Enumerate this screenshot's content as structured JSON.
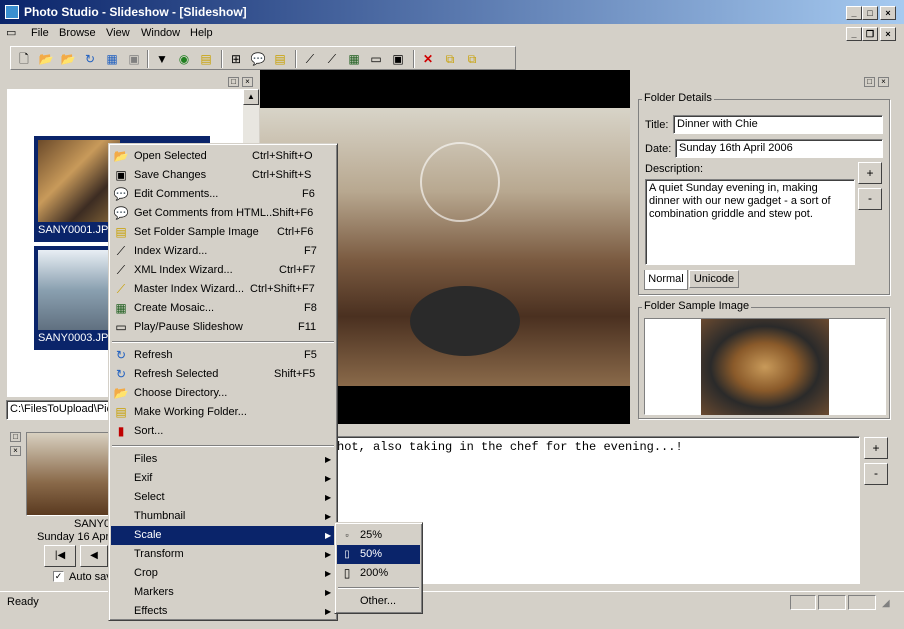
{
  "window": {
    "title": "Photo Studio - Slideshow - [Slideshow]"
  },
  "menubar": [
    "File",
    "Browse",
    "View",
    "Window",
    "Help"
  ],
  "toolbar_icons": [
    "new-icon",
    "open-icon",
    "open-web-icon",
    "refresh-icon",
    "index-icon",
    "save-icon",
    "comments-icon",
    "globe-icon",
    "folder-refresh-icon",
    "mosaic-icon",
    "speech-icon",
    "folder-comments-icon",
    "wand-icon",
    "xml-wand-icon",
    "grid-icon",
    "slideshow-icon",
    "presentation-icon",
    "delete-icon",
    "copy-icon",
    "paste-icon"
  ],
  "thumbnails": [
    {
      "caption": "SANY0001.JPG"
    },
    {
      "caption": "SANY0003.JPG"
    }
  ],
  "path_field": "C:\\FilesToUpload\\Pictures",
  "context_menu": {
    "items": [
      {
        "label": "Open Selected",
        "shortcut": "Ctrl+Shift+O",
        "icon": "open-icon"
      },
      {
        "label": "Save Changes",
        "shortcut": "Ctrl+Shift+S",
        "icon": "save-icon"
      },
      {
        "label": "Edit Comments...",
        "shortcut": "F6",
        "icon": "comment-icon"
      },
      {
        "label": "Get Comments from HTML...",
        "shortcut": "Shift+F6",
        "icon": "html-comment-icon"
      },
      {
        "label": "Set Folder Sample Image",
        "shortcut": "Ctrl+F6",
        "icon": "folder-image-icon"
      },
      {
        "label": "Index Wizard...",
        "shortcut": "F7",
        "icon": "wand-icon"
      },
      {
        "label": "XML Index Wizard...",
        "shortcut": "Ctrl+F7",
        "icon": "xml-wand-icon"
      },
      {
        "label": "Master Index Wizard...",
        "shortcut": "Ctrl+Shift+F7",
        "icon": "master-wand-icon"
      },
      {
        "label": "Create Mosaic...",
        "shortcut": "F8",
        "icon": "mosaic-icon"
      },
      {
        "label": "Play/Pause Slideshow",
        "shortcut": "F11",
        "icon": "slideshow-icon"
      },
      {
        "label": "Refresh",
        "shortcut": "F5",
        "icon": "refresh-icon"
      },
      {
        "label": "Refresh Selected",
        "shortcut": "Shift+F5",
        "icon": "refresh-selected-icon"
      },
      {
        "label": "Choose Directory...",
        "shortcut": "",
        "icon": "folder-open-icon"
      },
      {
        "label": "Make Working Folder...",
        "shortcut": "",
        "icon": "working-folder-icon"
      },
      {
        "label": "Sort...",
        "shortcut": "",
        "icon": "sort-icon"
      }
    ],
    "submenus": [
      "Files",
      "Exif",
      "Select",
      "Thumbnail",
      "Scale",
      "Transform",
      "Crop",
      "Markers",
      "Effects"
    ],
    "selected_submenu": "Scale"
  },
  "scale_submenu": {
    "items": [
      "25%",
      "50%",
      "200%"
    ],
    "selected": "50%",
    "other": "Other..."
  },
  "folder_details": {
    "group_label": "Folder Details",
    "title_label": "Title:",
    "title_value": "Dinner with Chie",
    "date_label": "Date:",
    "date_value": "Sunday 16th April 2006",
    "description_label": "Description:",
    "description_value": "A quiet Sunday evening in, making dinner with our new gadget - a sort of combination griddle and stew pot.",
    "tabs": [
      "Normal",
      "Unicode"
    ],
    "active_tab": "Normal",
    "plus": "+",
    "minus": "-"
  },
  "folder_sample": {
    "group_label": "Folder Sample Image"
  },
  "bottom": {
    "caption_short": "SANY0",
    "date_short": "Sunday 16 Apr",
    "comment_text": "hot, also taking in the chef for the evening...!",
    "auto_label": "Auto sav",
    "plus": "+",
    "minus": "-"
  },
  "status": {
    "text": "Ready"
  }
}
